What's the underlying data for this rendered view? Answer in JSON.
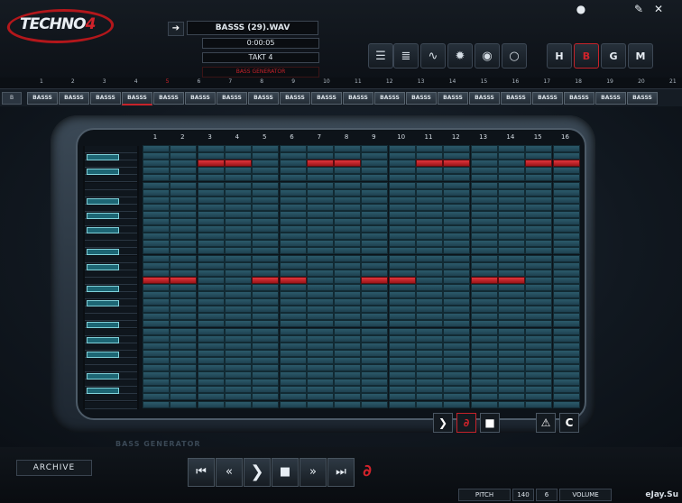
{
  "app": {
    "logo_text": "TECHNO",
    "logo_number": "4"
  },
  "header": {
    "arrow_icon": "arrow-right-icon",
    "filename": "BASSS (29).WAV",
    "time": "0:00:05",
    "takt": "TAKT 4",
    "red_label": "BASS GENERATOR"
  },
  "toolbar": {
    "left_buttons": [
      {
        "icon": "list-icon",
        "glyph": "☰"
      },
      {
        "icon": "list-detail-icon",
        "glyph": "≣"
      },
      {
        "icon": "waveform-icon",
        "glyph": "∿"
      },
      {
        "icon": "gear-icon",
        "glyph": "✹"
      },
      {
        "icon": "robot-icon",
        "glyph": "◉"
      },
      {
        "icon": "circle-icon",
        "glyph": "○"
      }
    ],
    "right_buttons": [
      {
        "icon": "h-gear-icon",
        "glyph": "H"
      },
      {
        "icon": "b-gear-icon",
        "glyph": "B"
      },
      {
        "icon": "g-gear-icon",
        "glyph": "G"
      },
      {
        "icon": "m-gear-icon",
        "glyph": "M"
      }
    ],
    "top_icons": [
      {
        "icon": "globe-icon",
        "glyph": "●"
      },
      {
        "icon": "wrench-icon",
        "glyph": "✎"
      },
      {
        "icon": "close-icon",
        "glyph": "✕"
      }
    ]
  },
  "ruler": {
    "numbers": [
      "1",
      "2",
      "3",
      "4",
      "5",
      "6",
      "7",
      "8",
      "9",
      "10",
      "11",
      "12",
      "13",
      "14",
      "15",
      "16",
      "17",
      "18",
      "19",
      "20",
      "21"
    ]
  },
  "tracks": {
    "lock_label": "B",
    "clip_label": "BASSS",
    "clip_count": 20,
    "selected_clip": 3
  },
  "sequencer": {
    "columns": [
      "1",
      "2",
      "3",
      "4",
      "5",
      "6",
      "7",
      "8",
      "9",
      "10",
      "11",
      "12",
      "13",
      "14",
      "15",
      "16"
    ],
    "rows": 36,
    "active_cells": [
      {
        "row": 3,
        "col": 3
      },
      {
        "row": 3,
        "col": 4
      },
      {
        "row": 3,
        "col": 7
      },
      {
        "row": 3,
        "col": 8
      },
      {
        "row": 3,
        "col": 11
      },
      {
        "row": 3,
        "col": 12
      },
      {
        "row": 3,
        "col": 15
      },
      {
        "row": 3,
        "col": 16
      },
      {
        "row": 19,
        "col": 1
      },
      {
        "row": 19,
        "col": 2
      },
      {
        "row": 19,
        "col": 5
      },
      {
        "row": 19,
        "col": 6
      },
      {
        "row": 19,
        "col": 9
      },
      {
        "row": 19,
        "col": 10
      },
      {
        "row": 19,
        "col": 13
      },
      {
        "row": 19,
        "col": 14
      }
    ],
    "generator_label": "BASS GENERATOR"
  },
  "panel_buttons": [
    {
      "icon": "play-small-icon",
      "glyph": "❯"
    },
    {
      "icon": "loop-icon",
      "glyph": "∂"
    },
    {
      "icon": "stop-small-icon",
      "glyph": "■"
    },
    {
      "icon": "warning-icon",
      "glyph": "⚠"
    },
    {
      "icon": "clear-icon",
      "glyph": "C"
    }
  ],
  "footer": {
    "archive_label": "ARCHIVE",
    "transport": [
      {
        "icon": "skip-start-icon",
        "glyph": "⏮"
      },
      {
        "icon": "rewind-icon",
        "glyph": "«"
      },
      {
        "icon": "play-icon",
        "glyph": "❯"
      },
      {
        "icon": "stop-icon",
        "glyph": "■"
      },
      {
        "icon": "fast-forward-icon",
        "glyph": "»"
      },
      {
        "icon": "skip-end-icon",
        "glyph": "⏭"
      }
    ],
    "loop_icon": "loop-icon",
    "pitch_label": "PITCH",
    "tempo": "140",
    "pitch_value": "6",
    "volume_label": "VOLUME",
    "credit": "eJay.Su"
  },
  "colors": {
    "accent": "#c6222a",
    "cell": "#2b5a6b",
    "cell_on": "#e1353c",
    "key": "#1d6674"
  }
}
